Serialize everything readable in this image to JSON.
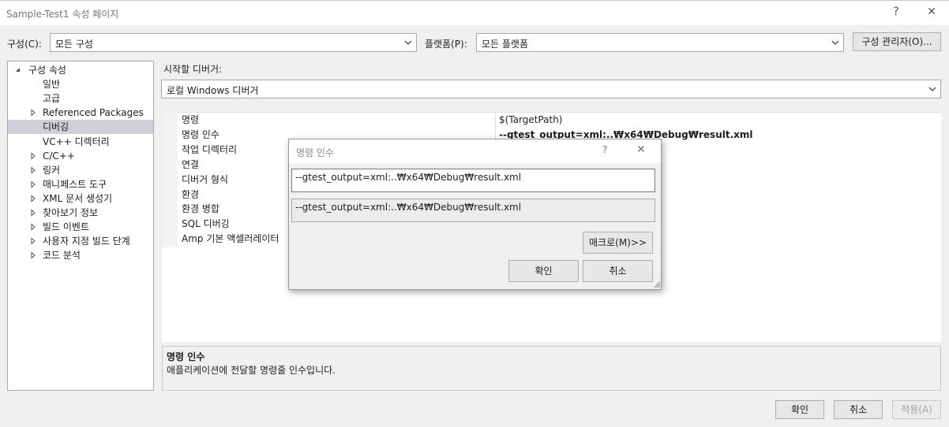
{
  "window": {
    "title": "Sample-Test1 속성 페이지",
    "help_glyph": "?",
    "close_glyph": "✕"
  },
  "config": {
    "config_label": "구성(C):",
    "config_value": "모든 구성",
    "platform_label": "플랫폼(P):",
    "platform_value": "모든 플랫폼",
    "manager_button": "구성 관리자(O)..."
  },
  "tree": {
    "items": [
      {
        "label": "구성 속성",
        "arrow": "expanded"
      },
      {
        "label": "일반",
        "arrow": "none"
      },
      {
        "label": "고급",
        "arrow": "none"
      },
      {
        "label": "Referenced Packages",
        "arrow": "collapsed"
      },
      {
        "label": "디버깅",
        "arrow": "none",
        "selected": true
      },
      {
        "label": "VC++ 디렉터리",
        "arrow": "none"
      },
      {
        "label": "C/C++",
        "arrow": "collapsed"
      },
      {
        "label": "링커",
        "arrow": "collapsed"
      },
      {
        "label": "매니페스트 도구",
        "arrow": "collapsed"
      },
      {
        "label": "XML 문서 생성기",
        "arrow": "collapsed"
      },
      {
        "label": "찾아보기 정보",
        "arrow": "collapsed"
      },
      {
        "label": "빌드 이벤트",
        "arrow": "collapsed"
      },
      {
        "label": "사용자 지정 빌드 단계",
        "arrow": "collapsed"
      },
      {
        "label": "코드 분석",
        "arrow": "collapsed"
      }
    ]
  },
  "debugger": {
    "label": "시작할 디버거:",
    "value": "로컬 Windows 디버거"
  },
  "properties": {
    "rows": [
      {
        "name": "명령",
        "value": "$(TargetPath)"
      },
      {
        "name": "명령 인수",
        "value": "--gtest_output=xml:..₩x64₩Debug₩result.xml",
        "bold": true
      },
      {
        "name": "작업 디렉터리",
        "value": ""
      },
      {
        "name": "연결",
        "value": ""
      },
      {
        "name": "디버거 형식",
        "value": ""
      },
      {
        "name": "환경",
        "value": ""
      },
      {
        "name": "환경 병합",
        "value": ""
      },
      {
        "name": "SQL 디버깅",
        "value": ""
      },
      {
        "name": "Amp 기본 액셀러레이터",
        "value": ""
      }
    ]
  },
  "description": {
    "title": "명령 인수",
    "text": "애플리케이션에 전달할 명령줄 인수입니다."
  },
  "footer": {
    "ok": "확인",
    "cancel": "취소",
    "apply": "적용(A)"
  },
  "dialog": {
    "title": "명령 인수",
    "help_glyph": "?",
    "close_glyph": "✕",
    "input_value": "--gtest_output=xml:..₩x64₩Debug₩result.xml",
    "preview_value": "--gtest_output=xml:..₩x64₩Debug₩result.xml",
    "macro_button": "매크로(M)>>",
    "ok": "확인",
    "cancel": "취소"
  }
}
